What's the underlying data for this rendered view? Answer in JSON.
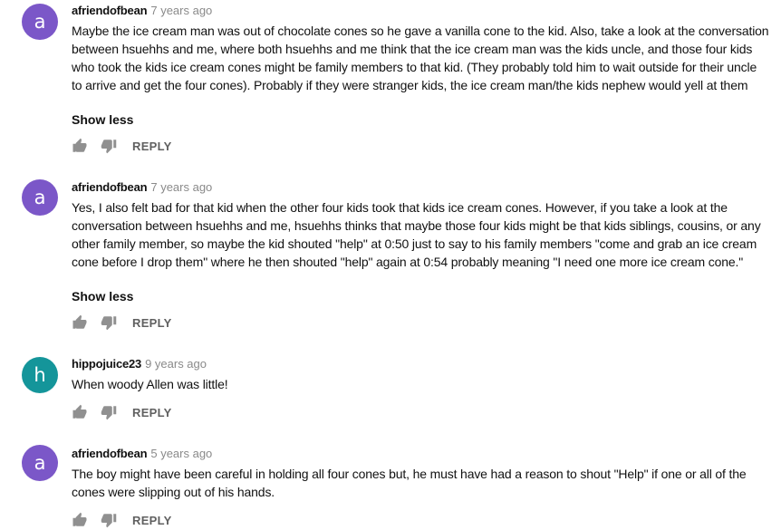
{
  "comments": [
    {
      "avatar_letter": "a",
      "avatar_color": "#7b57c8",
      "author": "afriendofbean",
      "time": "7 years ago",
      "text": "Maybe the ice cream man was out of chocolate cones so he gave a vanilla cone to the kid.  Also, take a look at the conversation between hsuehhs and me, where both hsuehhs and me think that the ice cream man was the kids uncle, and those four kids who took the kids ice cream cones might be family members to that kid.  (They probably told him to wait outside for their uncle to arrive and get the four cones).  Probably if they were stranger kids, the ice cream man/the kids nephew would yell at them",
      "toggle": "Show less",
      "reply": "REPLY"
    },
    {
      "avatar_letter": "a",
      "avatar_color": "#7b57c8",
      "author": "afriendofbean",
      "time": "7 years ago",
      "text": "Yes, I also felt bad for that kid when the other four kids took that kids ice cream cones.  However, if you take a look at the conversation between hsuehhs and me, hsuehhs thinks that maybe those four kids might be that kids siblings, cousins, or any other family member, so maybe the kid shouted \"help\" at 0:50 just to say to his family members \"come and grab an ice cream cone before I drop them\" where he then shouted \"help\" again at 0:54 probably meaning \"I need one more ice cream cone.\"",
      "toggle": "Show less",
      "reply": "REPLY"
    },
    {
      "avatar_letter": "h",
      "avatar_color": "#14959a",
      "author": "hippojuice23",
      "time": "9 years ago",
      "text": "When woody Allen was little!",
      "reply": "REPLY"
    },
    {
      "avatar_letter": "a",
      "avatar_color": "#7b57c8",
      "author": "afriendofbean",
      "time": "5 years ago",
      "text": "The boy might have been careful in holding all four cones but, he must have had a reason to shout \"Help\" if one or all of the cones were slipping out of his hands.",
      "reply": "REPLY"
    }
  ],
  "icons": {
    "like": "thumbs-up-icon",
    "dislike": "thumbs-down-icon",
    "color": "#909090"
  }
}
